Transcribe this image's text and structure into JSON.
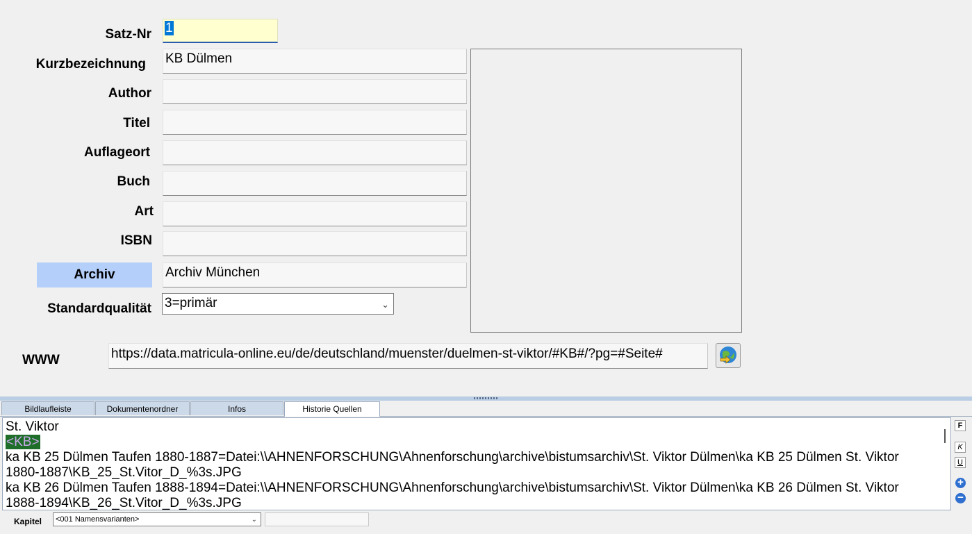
{
  "form": {
    "satznr_label": "Satz-Nr",
    "satznr_value": "1",
    "kurz_label": "Kurzbezeichnung",
    "kurz_value": "KB Dülmen",
    "author_label": "Author",
    "author_value": "",
    "titel_label": "Titel",
    "titel_value": "",
    "auflageort_label": "Auflageort",
    "auflageort_value": "",
    "buch_label": "Buch",
    "buch_value": "",
    "art_label": "Art",
    "art_value": "",
    "isbn_label": "ISBN",
    "isbn_value": "",
    "archiv_label": "Archiv",
    "archiv_value": "Archiv München",
    "quality_label": "Standardqualität",
    "quality_value": "3=primär",
    "www_label": "WWW",
    "www_value": "https://data.matricula-online.eu/de/deutschland/muenster/duelmen-st-viktor/#KB#/?pg=#Seite#"
  },
  "tabs": [
    {
      "label": "Bildlaufleiste"
    },
    {
      "label": "Dokumentenordner"
    },
    {
      "label": "Infos"
    },
    {
      "label": "Historie Quellen"
    }
  ],
  "history": {
    "line1": "St. Viktor",
    "tag": "<KB>",
    "entry1a": "ka KB 25 Dülmen Taufen 1880-1887=Datei:\\\\AHNENFORSCHUNG\\Ahnenforschung\\archive\\bistumsarchiv\\St. Viktor Dülmen\\ka KB 25 Dülmen St. Viktor",
    "entry1b": "1880-1887\\KB_25_St.Vitor_D_%3s.JPG",
    "entry2a": "ka KB 26 Dülmen Taufen 1888-1894=Datei:\\\\AHNENFORSCHUNG\\Ahnenforschung\\archive\\bistumsarchiv\\St. Viktor Dülmen\\ka KB 26 Dülmen St. Viktor",
    "entry2b": "1888-1894\\KB_26_St.Vitor_D_%3s.JPG"
  },
  "format_buttons": {
    "bold": "F",
    "italic": "K",
    "underline": "U",
    "plus": "+",
    "minus": "−"
  },
  "bottom": {
    "kapitel_label": "Kapitel",
    "kapitel_value": "<001 Namensvarianten>"
  },
  "colors": {
    "archiv_button": "#b4cffa",
    "satznr_bg": "#ffffd0",
    "tag_bg": "#1e6e2a"
  },
  "icons": {
    "globe": "globe-arrow-icon",
    "chevron": "chevron-down-icon"
  }
}
